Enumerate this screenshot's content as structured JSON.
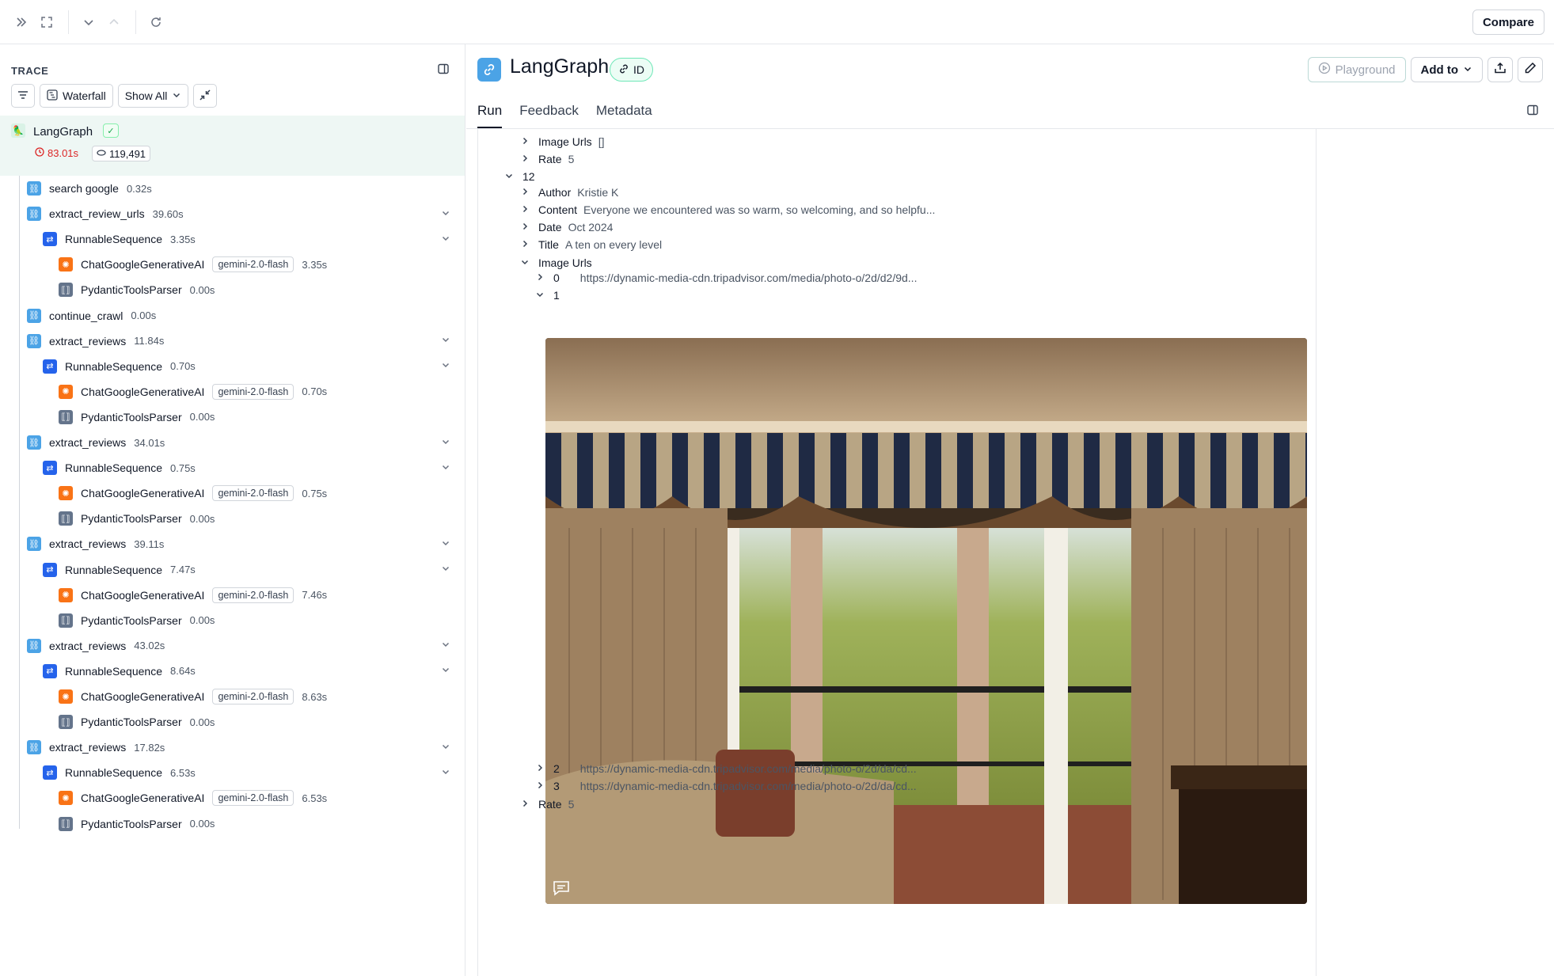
{
  "toolbar": {
    "compare_label": "Compare"
  },
  "trace": {
    "label": "TRACE",
    "waterfall_label": "Waterfall",
    "show_all_label": "Show All",
    "root": {
      "name": "LangGraph",
      "latency": "83.01s",
      "tokens": "119,491"
    },
    "nodes": [
      {
        "name": "search google",
        "time": "0.32s",
        "type": "chain",
        "model": ""
      },
      {
        "name": "extract_review_urls",
        "time": "39.60s",
        "type": "chain",
        "model": ""
      },
      {
        "name": "RunnableSequence",
        "time": "3.35s",
        "type": "seq",
        "model": ""
      },
      {
        "name": "ChatGoogleGenerativeAI",
        "time": "3.35s",
        "type": "llm",
        "model": "gemini-2.0-flash"
      },
      {
        "name": "PydanticToolsParser",
        "time": "0.00s",
        "type": "parser",
        "model": ""
      },
      {
        "name": "continue_crawl",
        "time": "0.00s",
        "type": "chain",
        "model": ""
      },
      {
        "name": "extract_reviews",
        "time": "11.84s",
        "type": "chain",
        "model": ""
      },
      {
        "name": "RunnableSequence",
        "time": "0.70s",
        "type": "seq",
        "model": ""
      },
      {
        "name": "ChatGoogleGenerativeAI",
        "time": "0.70s",
        "type": "llm",
        "model": "gemini-2.0-flash"
      },
      {
        "name": "PydanticToolsParser",
        "time": "0.00s",
        "type": "parser",
        "model": ""
      },
      {
        "name": "extract_reviews",
        "time": "34.01s",
        "type": "chain",
        "model": ""
      },
      {
        "name": "RunnableSequence",
        "time": "0.75s",
        "type": "seq",
        "model": ""
      },
      {
        "name": "ChatGoogleGenerativeAI",
        "time": "0.75s",
        "type": "llm",
        "model": "gemini-2.0-flash"
      },
      {
        "name": "PydanticToolsParser",
        "time": "0.00s",
        "type": "parser",
        "model": ""
      },
      {
        "name": "extract_reviews",
        "time": "39.11s",
        "type": "chain",
        "model": ""
      },
      {
        "name": "RunnableSequence",
        "time": "7.47s",
        "type": "seq",
        "model": ""
      },
      {
        "name": "ChatGoogleGenerativeAI",
        "time": "7.46s",
        "type": "llm",
        "model": "gemini-2.0-flash"
      },
      {
        "name": "PydanticToolsParser",
        "time": "0.00s",
        "type": "parser",
        "model": ""
      },
      {
        "name": "extract_reviews",
        "time": "43.02s",
        "type": "chain",
        "model": ""
      },
      {
        "name": "RunnableSequence",
        "time": "8.64s",
        "type": "seq",
        "model": ""
      },
      {
        "name": "ChatGoogleGenerativeAI",
        "time": "8.63s",
        "type": "llm",
        "model": "gemini-2.0-flash"
      },
      {
        "name": "PydanticToolsParser",
        "time": "0.00s",
        "type": "parser",
        "model": ""
      },
      {
        "name": "extract_reviews",
        "time": "17.82s",
        "type": "chain",
        "model": ""
      },
      {
        "name": "RunnableSequence",
        "time": "6.53s",
        "type": "seq",
        "model": ""
      },
      {
        "name": "ChatGoogleGenerativeAI",
        "time": "6.53s",
        "type": "llm",
        "model": "gemini-2.0-flash"
      },
      {
        "name": "PydanticToolsParser",
        "time": "0.00s",
        "type": "parser",
        "model": ""
      }
    ]
  },
  "run": {
    "title": "LangGraph",
    "id_label": "ID",
    "playground_label": "Playground",
    "add_to_label": "Add to",
    "tabs": [
      "Run",
      "Feedback",
      "Metadata"
    ],
    "rows": [
      {
        "key": "Image Urls",
        "value": "[]",
        "chev": "right"
      },
      {
        "key": "Rate",
        "value": "5",
        "chev": "right"
      },
      {
        "key": "12",
        "value": "",
        "chev": "down"
      },
      {
        "key": "Author",
        "value": "Kristie K",
        "chev": "right"
      },
      {
        "key": "Content",
        "value": "Everyone we encountered was so warm, so welcoming, and so helpfu...",
        "chev": "right"
      },
      {
        "key": "Date",
        "value": "Oct 2024",
        "chev": "right"
      },
      {
        "key": "Title",
        "value": "A ten on every level",
        "chev": "right"
      },
      {
        "key": "Image Urls",
        "value": "",
        "chev": "down"
      },
      {
        "key": "0",
        "value": "https://dynamic-media-cdn.tripadvisor.com/media/photo-o/2d/d2/9d...",
        "chev": "right"
      },
      {
        "key": "1",
        "value": "",
        "chev": "down"
      },
      {
        "key": "2",
        "value": "https://dynamic-media-cdn.tripadvisor.com/media/photo-o/2d/da/cd...",
        "chev": "right"
      },
      {
        "key": "3",
        "value": "https://dynamic-media-cdn.tripadvisor.com/media/photo-o/2d/da/cd...",
        "chev": "right"
      },
      {
        "key": "Rate",
        "value": "5",
        "chev": "right"
      }
    ]
  },
  "icons": {
    "sidebar_expand": "double-chevron-right-icon",
    "fullscreen": "expand-icon",
    "next": "chevron-down-icon",
    "prev": "chevron-up-icon",
    "refresh": "refresh-icon",
    "filter": "filter-icon",
    "collapse": "collapse-icon",
    "panel": "panel-icon",
    "link": "link-icon",
    "export": "export-icon",
    "edit": "pencil-icon",
    "comment": "comment-icon"
  }
}
